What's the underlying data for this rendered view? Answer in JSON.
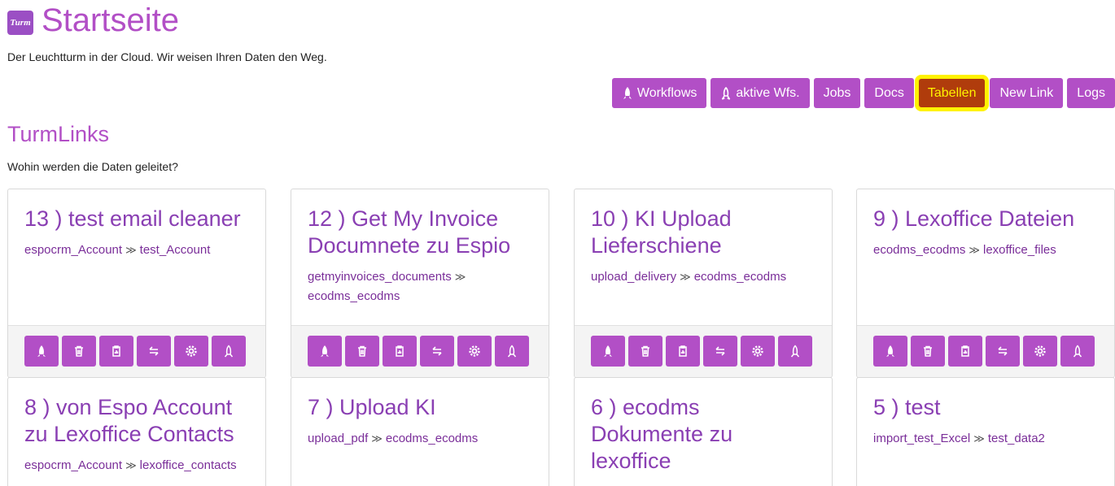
{
  "header": {
    "logo_text": "Turm",
    "title": "Startseite",
    "subtitle": "Der Leuchtturm in der Cloud. Wir weisen Ihren Daten den Weg."
  },
  "nav": {
    "workflows": "Workflows",
    "active_wfs": "aktive Wfs.",
    "jobs": "Jobs",
    "docs": "Docs",
    "tables": "Tabellen",
    "new_link": "New Link",
    "logs": "Logs"
  },
  "section": {
    "title": "TurmLinks",
    "subtitle": "Wohin werden die Daten geleitet?"
  },
  "cards": [
    {
      "title": "13 ) test email cleaner",
      "from": "espocrm_Account",
      "to": "test_Account"
    },
    {
      "title": "12 ) Get My Invoice Documnete zu Espio",
      "from": "getmyinvoices_documents",
      "to": "ecodms_ecodms"
    },
    {
      "title": "10 ) KI Upload Lieferschiene",
      "from": "upload_delivery",
      "to": "ecodms_ecodms"
    },
    {
      "title": "9 ) Lexoffice Dateien",
      "from": "ecodms_ecodms",
      "to": "lexoffice_files"
    },
    {
      "title": "8 ) von Espo Account zu Lexoffice Contacts",
      "from": "espocrm_Account",
      "to": "lexoffice_contacts"
    },
    {
      "title": "7 ) Upload KI",
      "from": "upload_pdf",
      "to": "ecodms_ecodms"
    },
    {
      "title": "6 ) ecodms Dokumente zu lexoffice",
      "from": "",
      "to": ""
    },
    {
      "title": "5 ) test",
      "from": "import_test_Excel",
      "to": "test_data2"
    }
  ],
  "colors": {
    "accent": "#b24fc6",
    "active_bg": "#b03c0c",
    "highlight": "#fff200"
  }
}
